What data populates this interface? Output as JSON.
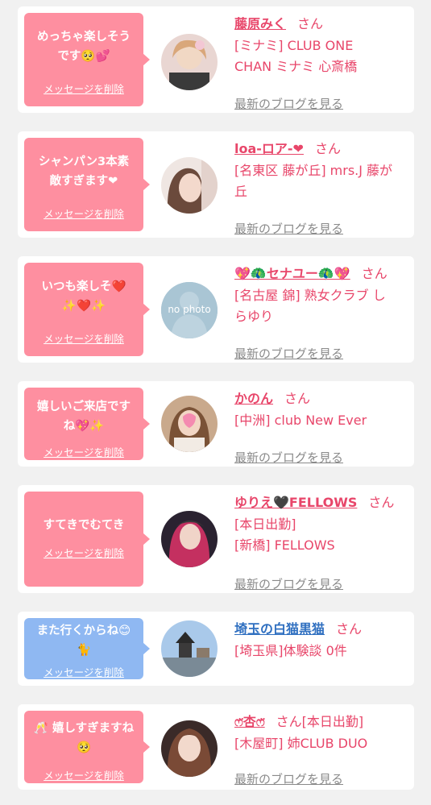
{
  "colors": {
    "pink_bubble": "#fe8fa0",
    "blue_bubble": "#8fb8f2",
    "name_pink": "#e8466a",
    "name_blue": "#2f6fc0",
    "blog_link": "#8a8a8a"
  },
  "cards": [
    {
      "message_line1": "めっちゃ楽しそう",
      "message_line2": "です🥺💕",
      "delete_label": "メッセージを削除",
      "name": "藤原みく",
      "san": "さん",
      "shop_line1": "[ミナミ] CLUB ONE",
      "shop_line2": "CHAN ミナミ 心斎橋",
      "blog_label": "最新のブログを見る"
    },
    {
      "message_line1": "シャンパン3本素",
      "message_line2": "敵すぎます❤",
      "delete_label": "メッセージを削除",
      "name": "loa-ロア-❤",
      "san": "さん",
      "shop_line1": "[名東区 藤が丘] mrs.J 藤が",
      "shop_line2": "丘",
      "blog_label": "最新のブログを見る"
    },
    {
      "message_line1": "いつも楽しそ❤️",
      "message_line2": "✨❤️✨",
      "delete_label": "メッセージを削除",
      "name": "💖🦚セナユー🦚💖",
      "san": "さん",
      "shop_line1": "[名古屋 錦] 熟女クラブ し",
      "shop_line2": "らゆり",
      "blog_label": "最新のブログを見る",
      "avatar_text": "no photo"
    },
    {
      "message_line1": "嬉しいご来店です",
      "message_line2": "ね💖✨",
      "delete_label": "メッセージを削除",
      "name": "かのん",
      "san": "さん",
      "shop_line1": "[中洲] club New Ever",
      "blog_label": "最新のブログを見る"
    },
    {
      "message_line1": "すてきでむてき",
      "delete_label": "メッセージを削除",
      "name": "ゆりえ🖤FELLOWS",
      "san": "さん",
      "shop_line1": "[本日出勤]",
      "shop_line2": "[新橋] FELLOWS",
      "blog_label": "最新のブログを見る"
    },
    {
      "message_line1": "また行くからね😊",
      "message_line2": "🐈",
      "delete_label": "メッセージを削除",
      "name": "埼玉の白猫黒猫",
      "san": "さん",
      "shop_line1": "[埼玉県]体験談 0件"
    },
    {
      "message_line1": "🥂 嬉しすぎますね",
      "message_line2": "🥺",
      "delete_label": "メッセージを削除",
      "name": "ෆ̈杏ෆ̈",
      "san": "さん[本日出勤]",
      "shop_line1": "[木屋町] 姉CLUB DUO",
      "blog_label": "最新のブログを見る"
    }
  ]
}
